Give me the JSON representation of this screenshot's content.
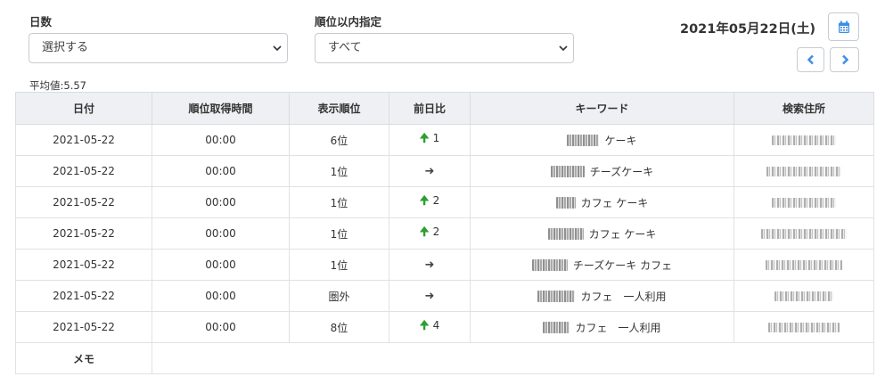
{
  "filters": {
    "days_label": "日数",
    "days_value": "選択する",
    "rank_label": "順位以内指定",
    "rank_value": "すべて"
  },
  "date": {
    "display": "2021年05月22日(土)"
  },
  "icons": {
    "calendar": "calendar-icon",
    "prev": "chevron-left-icon",
    "next": "chevron-right-icon"
  },
  "colors": {
    "accent": "#3a8ee6",
    "up_arrow": "#2e9e2e",
    "header_bg": "#eef0f3"
  },
  "summary": {
    "average": "平均値:5.57"
  },
  "table": {
    "headers": [
      "日付",
      "順位取得時間",
      "表示順位",
      "前日比",
      "キーワード",
      "検索住所"
    ],
    "rows": [
      {
        "date": "2021-05-22",
        "time": "00:00",
        "rank": "6位",
        "trend": "up",
        "change": "1",
        "keyword": "ケーキ"
      },
      {
        "date": "2021-05-22",
        "time": "00:00",
        "rank": "1位",
        "trend": "same",
        "change": "",
        "keyword": "チーズケーキ"
      },
      {
        "date": "2021-05-22",
        "time": "00:00",
        "rank": "1位",
        "trend": "up",
        "change": "2",
        "keyword": "カフェ ケーキ"
      },
      {
        "date": "2021-05-22",
        "time": "00:00",
        "rank": "1位",
        "trend": "up",
        "change": "2",
        "keyword": "カフェ ケーキ"
      },
      {
        "date": "2021-05-22",
        "time": "00:00",
        "rank": "1位",
        "trend": "same",
        "change": "",
        "keyword": "チーズケーキ カフェ"
      },
      {
        "date": "2021-05-22",
        "time": "00:00",
        "rank": "圏外",
        "trend": "same",
        "change": "",
        "keyword": "カフェ　一人利用"
      },
      {
        "date": "2021-05-22",
        "time": "00:00",
        "rank": "8位",
        "trend": "up",
        "change": "4",
        "keyword": "カフェ　一人利用"
      }
    ],
    "memo_label": "メモ"
  }
}
